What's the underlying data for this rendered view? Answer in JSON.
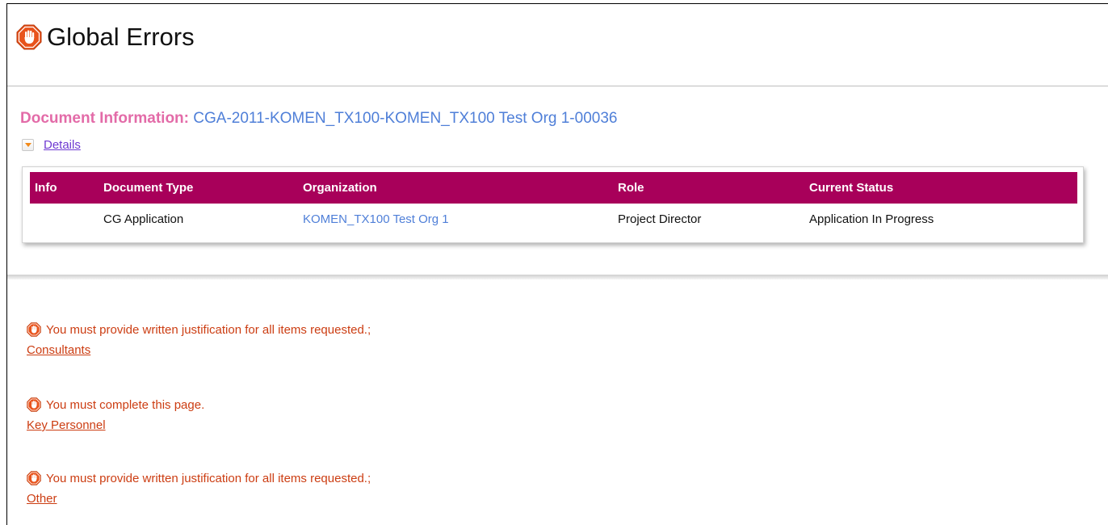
{
  "page": {
    "title": "Global Errors",
    "title_icon": "stop-hand-icon"
  },
  "document": {
    "label": "Document Information:",
    "value": "CGA-2011-KOMEN_TX100-KOMEN_TX100 Test Org 1-00036",
    "details_label": "Details",
    "details_icon": "expand-arrow-icon"
  },
  "table": {
    "headers": [
      "Info",
      "Document Type",
      "Organization",
      "Role",
      "Current Status"
    ],
    "rows": [
      {
        "info": "",
        "document_type": "CG Application",
        "organization": "KOMEN_TX100 Test Org 1",
        "role": "Project Director",
        "current_status": "Application In Progress"
      }
    ]
  },
  "errors": [
    {
      "message": "You must provide written justification for all items requested.;",
      "link": "Consultants",
      "icon": "stop-hand-icon"
    },
    {
      "message": "You must complete this page.",
      "link": "Key Personnel",
      "icon": "stop-hand-icon"
    },
    {
      "message": "You must provide written justification for all items requested.;",
      "link": "Other",
      "icon": "stop-hand-icon"
    }
  ],
  "colors": {
    "header_bar": "#a8005a",
    "doc_label": "#e36ba8",
    "doc_value": "#4f7fd8",
    "error_text": "#cc3d12",
    "details_link": "#6f3ad2"
  }
}
